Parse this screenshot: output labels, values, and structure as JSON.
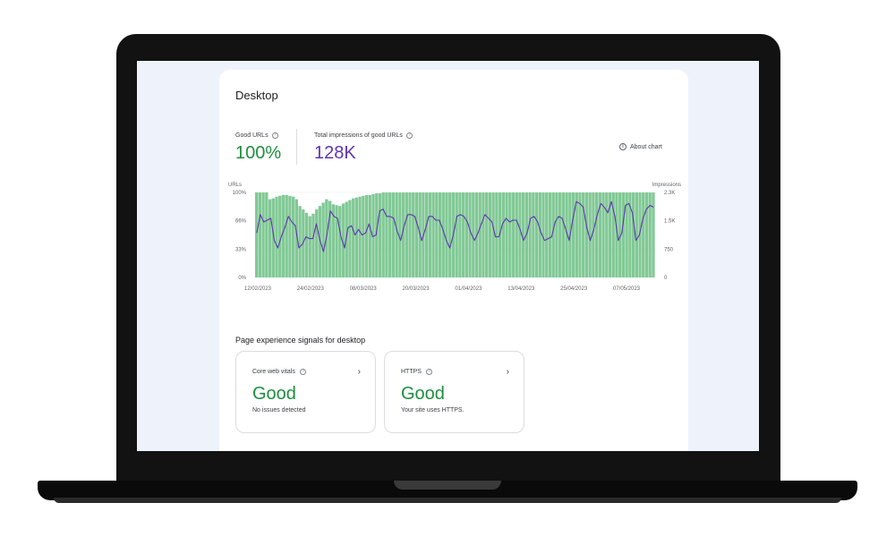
{
  "page": {
    "title": "Desktop",
    "about_chart": "About chart",
    "info_icon": "i"
  },
  "metrics": {
    "good_urls": {
      "label": "Good URLs",
      "value": "100%",
      "color": "#1e8e3e"
    },
    "impressions": {
      "label": "Total impressions of good URLs",
      "value": "128K",
      "color": "#5e35b1"
    }
  },
  "chart_data": {
    "type": "bar",
    "bar_color": "#81c995",
    "line_color": "#5e35b1",
    "left_axis": {
      "label": "URLs",
      "ticks": [
        "100%",
        "66%",
        "33%",
        "0%"
      ],
      "ylim": [
        0,
        100
      ]
    },
    "right_axis": {
      "label": "Impressions",
      "ticks": [
        "2.3K",
        "1.5K",
        "750",
        "0"
      ],
      "ylim": [
        0,
        2300
      ]
    },
    "x_ticks": [
      "12/02/2023",
      "24/02/2023",
      "08/03/2023",
      "20/03/2023",
      "01/04/2023",
      "13/04/2023",
      "25/04/2023",
      "07/05/2023"
    ],
    "bar_series": {
      "name": "URLs",
      "values": [
        100,
        100,
        100,
        100,
        92,
        93,
        95,
        96,
        97,
        97,
        96,
        95,
        92,
        84,
        80,
        76,
        72,
        75,
        80,
        84,
        88,
        92,
        90,
        86,
        85,
        84,
        87,
        89,
        91,
        93,
        94,
        95,
        96,
        97,
        97,
        98,
        99,
        99,
        100,
        100,
        100,
        100,
        100,
        100,
        100,
        100,
        100,
        100,
        100,
        100,
        100,
        100,
        100,
        100,
        100,
        100,
        100,
        100,
        100,
        100,
        100,
        100,
        100,
        100,
        100,
        100,
        100,
        100,
        100,
        100,
        100,
        100,
        100,
        100,
        100,
        100,
        100,
        100,
        100,
        100,
        100,
        100,
        100,
        100,
        100,
        100,
        100,
        100,
        100,
        100,
        100,
        100,
        100,
        100,
        100,
        100,
        100,
        100,
        100,
        100,
        100,
        100,
        100,
        100,
        100,
        100,
        100,
        100,
        100,
        100,
        100,
        100,
        100,
        100,
        100,
        100,
        100,
        100,
        100,
        100
      ]
    },
    "line_series": {
      "name": "Impressions",
      "values": [
        1200,
        1700,
        1500,
        1550,
        1600,
        1000,
        800,
        1100,
        1350,
        1650,
        1500,
        1400,
        800,
        900,
        1100,
        1050,
        1050,
        1450,
        1000,
        700,
        1150,
        1800,
        1650,
        1600,
        1100,
        800,
        1350,
        1400,
        1150,
        1300,
        1150,
        1200,
        1450,
        1100,
        1150,
        1800,
        1850,
        1650,
        1650,
        1600,
        1250,
        1000,
        1400,
        1700,
        1700,
        1650,
        1350,
        1000,
        1300,
        1650,
        1650,
        1550,
        1550,
        1300,
        1000,
        800,
        1150,
        1650,
        1700,
        1650,
        1500,
        1200,
        1000,
        1200,
        1450,
        1700,
        1600,
        1500,
        1100,
        1100,
        1450,
        1600,
        1500,
        1550,
        1550,
        1300,
        1000,
        1200,
        1600,
        1650,
        1500,
        1200,
        1000,
        1050,
        1100,
        1500,
        1650,
        1600,
        1300,
        1000,
        1550,
        2050,
        2000,
        1900,
        1350,
        1000,
        1300,
        1700,
        2000,
        1900,
        1750,
        2050,
        1650,
        1000,
        1200,
        1950,
        2000,
        1750,
        1000,
        1150,
        1600,
        1850,
        1950,
        1900
      ]
    }
  },
  "signals": {
    "section_title": "Page experience signals for desktop",
    "cards": [
      {
        "title": "Core web vitals",
        "status": "Good",
        "description": "No issues detected"
      },
      {
        "title": "HTTPS",
        "status": "Good",
        "description": "Your site uses HTTPS."
      }
    ]
  }
}
